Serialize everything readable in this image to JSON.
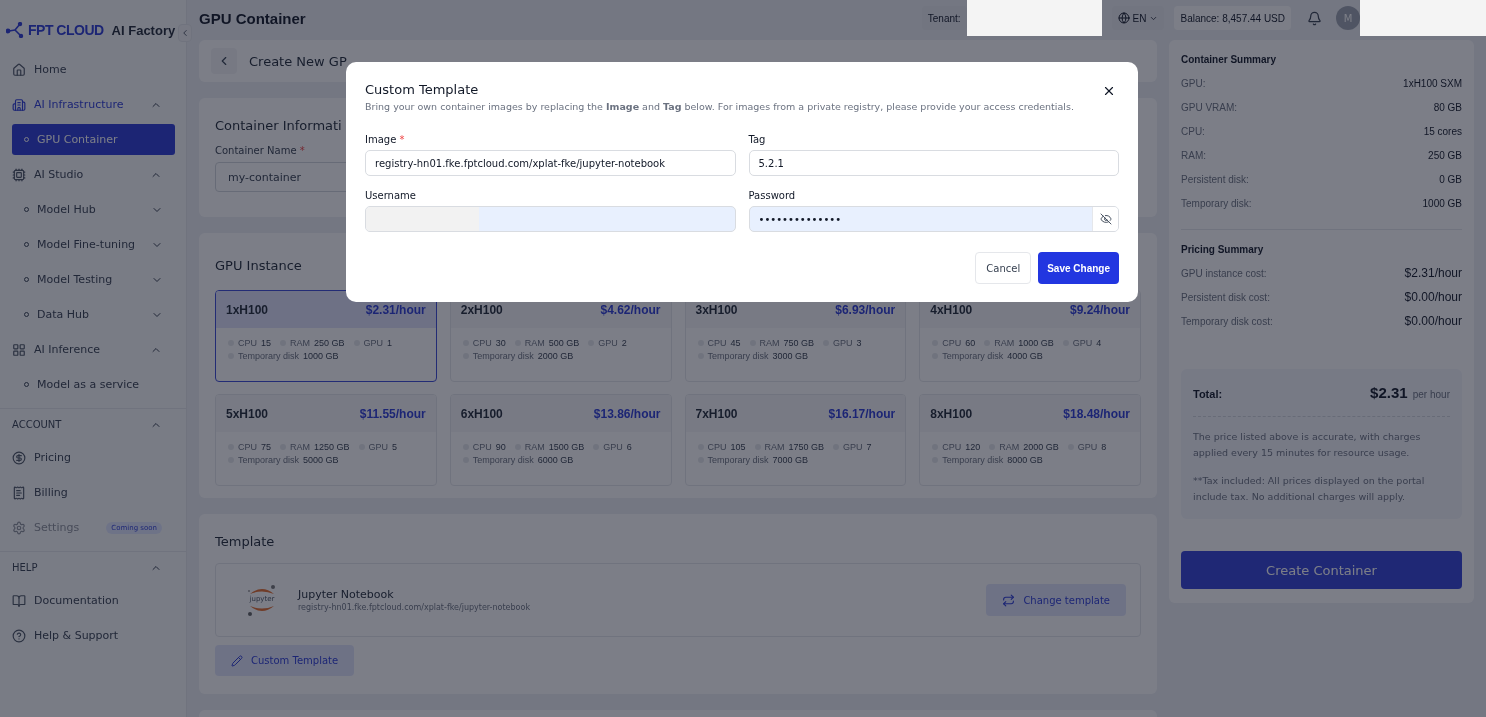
{
  "sidebar": {
    "brand": "FPT CLOUD",
    "product": "AI Factory",
    "sections": [
      {
        "items": [
          {
            "label": "Home"
          },
          {
            "label": "AI Infrastructure",
            "expanded": true,
            "children": [
              {
                "label": "GPU Container",
                "selected": true
              }
            ]
          },
          {
            "label": "AI Studio",
            "expanded": true,
            "children": [
              {
                "label": "Model Hub",
                "selected": false,
                "expanded": false
              },
              {
                "label": "Model Fine-tuning",
                "selected": false,
                "expanded": false
              },
              {
                "label": "Model Testing",
                "selected": false,
                "expanded": false
              },
              {
                "label": "Data Hub",
                "selected": false,
                "expanded": false
              }
            ]
          },
          {
            "label": "AI Inference",
            "expanded": true,
            "children": [
              {
                "label": "Model as a service",
                "selected": false
              }
            ]
          }
        ]
      },
      {
        "heading": "ACCOUNT",
        "expanded": true,
        "items": [
          {
            "label": "Pricing"
          },
          {
            "label": "Billing"
          },
          {
            "label": "Settings",
            "disabled": true,
            "badge": "Coming soon"
          }
        ]
      },
      {
        "heading": "HELP",
        "expanded": true,
        "items": [
          {
            "label": "Documentation"
          },
          {
            "label": "Help & Support"
          }
        ]
      }
    ]
  },
  "header": {
    "title": "GPU Container",
    "tenant": "Tenant:",
    "language": "EN",
    "balance": "Balance: 8,457.44 USD",
    "avatar": "M"
  },
  "page": {
    "title": "Create New GP"
  },
  "container_info": {
    "title": "Container Informati",
    "name_label": "Container Name",
    "required_mark": "*",
    "name_value": "my-container"
  },
  "gpu_instance": {
    "title": "GPU Instance",
    "options": [
      {
        "name": "1xH100",
        "price": "$2.31/hour",
        "selected": true,
        "specs": [
          {
            "label": "CPU",
            "value": "15"
          },
          {
            "label": "RAM",
            "value": "250 GB"
          },
          {
            "label": "GPU",
            "value": "1"
          },
          {
            "label": "Temporary disk",
            "value": "1000 GB"
          }
        ]
      },
      {
        "name": "2xH100",
        "price": "$4.62/hour",
        "selected": false,
        "specs": [
          {
            "label": "CPU",
            "value": "30"
          },
          {
            "label": "RAM",
            "value": "500 GB"
          },
          {
            "label": "GPU",
            "value": "2"
          },
          {
            "label": "Temporary disk",
            "value": "2000 GB"
          }
        ]
      },
      {
        "name": "3xH100",
        "price": "$6.93/hour",
        "selected": false,
        "specs": [
          {
            "label": "CPU",
            "value": "45"
          },
          {
            "label": "RAM",
            "value": "750 GB"
          },
          {
            "label": "GPU",
            "value": "3"
          },
          {
            "label": "Temporary disk",
            "value": "3000 GB"
          }
        ]
      },
      {
        "name": "4xH100",
        "price": "$9.24/hour",
        "selected": false,
        "specs": [
          {
            "label": "CPU",
            "value": "60"
          },
          {
            "label": "RAM",
            "value": "1000 GB"
          },
          {
            "label": "GPU",
            "value": "4"
          },
          {
            "label": "Temporary disk",
            "value": "4000 GB"
          }
        ]
      },
      {
        "name": "5xH100",
        "price": "$11.55/hour",
        "selected": false,
        "specs": [
          {
            "label": "CPU",
            "value": "75"
          },
          {
            "label": "RAM",
            "value": "1250 GB"
          },
          {
            "label": "GPU",
            "value": "5"
          },
          {
            "label": "Temporary disk",
            "value": "5000 GB"
          }
        ]
      },
      {
        "name": "6xH100",
        "price": "$13.86/hour",
        "selected": false,
        "specs": [
          {
            "label": "CPU",
            "value": "90"
          },
          {
            "label": "RAM",
            "value": "1500 GB"
          },
          {
            "label": "GPU",
            "value": "6"
          },
          {
            "label": "Temporary disk",
            "value": "6000 GB"
          }
        ]
      },
      {
        "name": "7xH100",
        "price": "$16.17/hour",
        "selected": false,
        "specs": [
          {
            "label": "CPU",
            "value": "105"
          },
          {
            "label": "RAM",
            "value": "1750 GB"
          },
          {
            "label": "GPU",
            "value": "7"
          },
          {
            "label": "Temporary disk",
            "value": "7000 GB"
          }
        ]
      },
      {
        "name": "8xH100",
        "price": "$18.48/hour",
        "selected": false,
        "specs": [
          {
            "label": "CPU",
            "value": "120"
          },
          {
            "label": "RAM",
            "value": "2000 GB"
          },
          {
            "label": "GPU",
            "value": "8"
          },
          {
            "label": "Temporary disk",
            "value": "8000 GB"
          }
        ]
      }
    ]
  },
  "template": {
    "title": "Template",
    "logo_text": "jupyter",
    "name": "Jupyter Notebook",
    "image": "registry-hn01.fke.fptcloud.com/xplat-fke/jupyter-notebook",
    "change_button": "Change template",
    "custom_button": "Custom Template"
  },
  "summary": {
    "title": "Container Summary",
    "rows": [
      {
        "label": "GPU:",
        "value": "1xH100 SXM"
      },
      {
        "label": "GPU VRAM:",
        "value": "80 GB"
      },
      {
        "label": "CPU:",
        "value": "15 cores"
      },
      {
        "label": "RAM:",
        "value": "250 GB"
      },
      {
        "label": "Persistent disk:",
        "value": "0 GB"
      },
      {
        "label": "Temporary disk:",
        "value": "1000 GB"
      }
    ],
    "pricing_title": "Pricing Summary",
    "pricing_rows": [
      {
        "label": "GPU instance cost:",
        "value": "$2.31/hour"
      },
      {
        "label": "Persistent disk cost:",
        "value": "$0.00/hour"
      },
      {
        "label": "Temporary disk cost:",
        "value": "$0.00/hour"
      }
    ],
    "total_label": "Total:",
    "total_value": "$2.31",
    "total_unit": "per hour",
    "notes": [
      "The price listed above is accurate, with charges applied every 15 minutes for resource usage.",
      "**Tax included: All prices displayed on the portal include tax. No additional charges will apply."
    ],
    "create_button": "Create Container"
  },
  "modal": {
    "title": "Custom Template",
    "description": "Bring your own container images by replacing the **Image** and **Tag** below. For images from a private registry, please provide your access credentials.",
    "fields": [
      {
        "kind": "text",
        "label": "Image",
        "required_mark": "*",
        "value": "registry-hn01.fke.fptcloud.com/xplat-fke/jupyter-notebook"
      },
      {
        "kind": "text",
        "label": "Tag",
        "value": "5.2.1"
      },
      {
        "kind": "redacted",
        "label": "Username",
        "autofilled": true
      },
      {
        "kind": "password",
        "label": "Password",
        "autofilled": true,
        "value": "••••••••••••••"
      }
    ],
    "cancel_button": "Cancel",
    "save_button": "Save Change"
  }
}
